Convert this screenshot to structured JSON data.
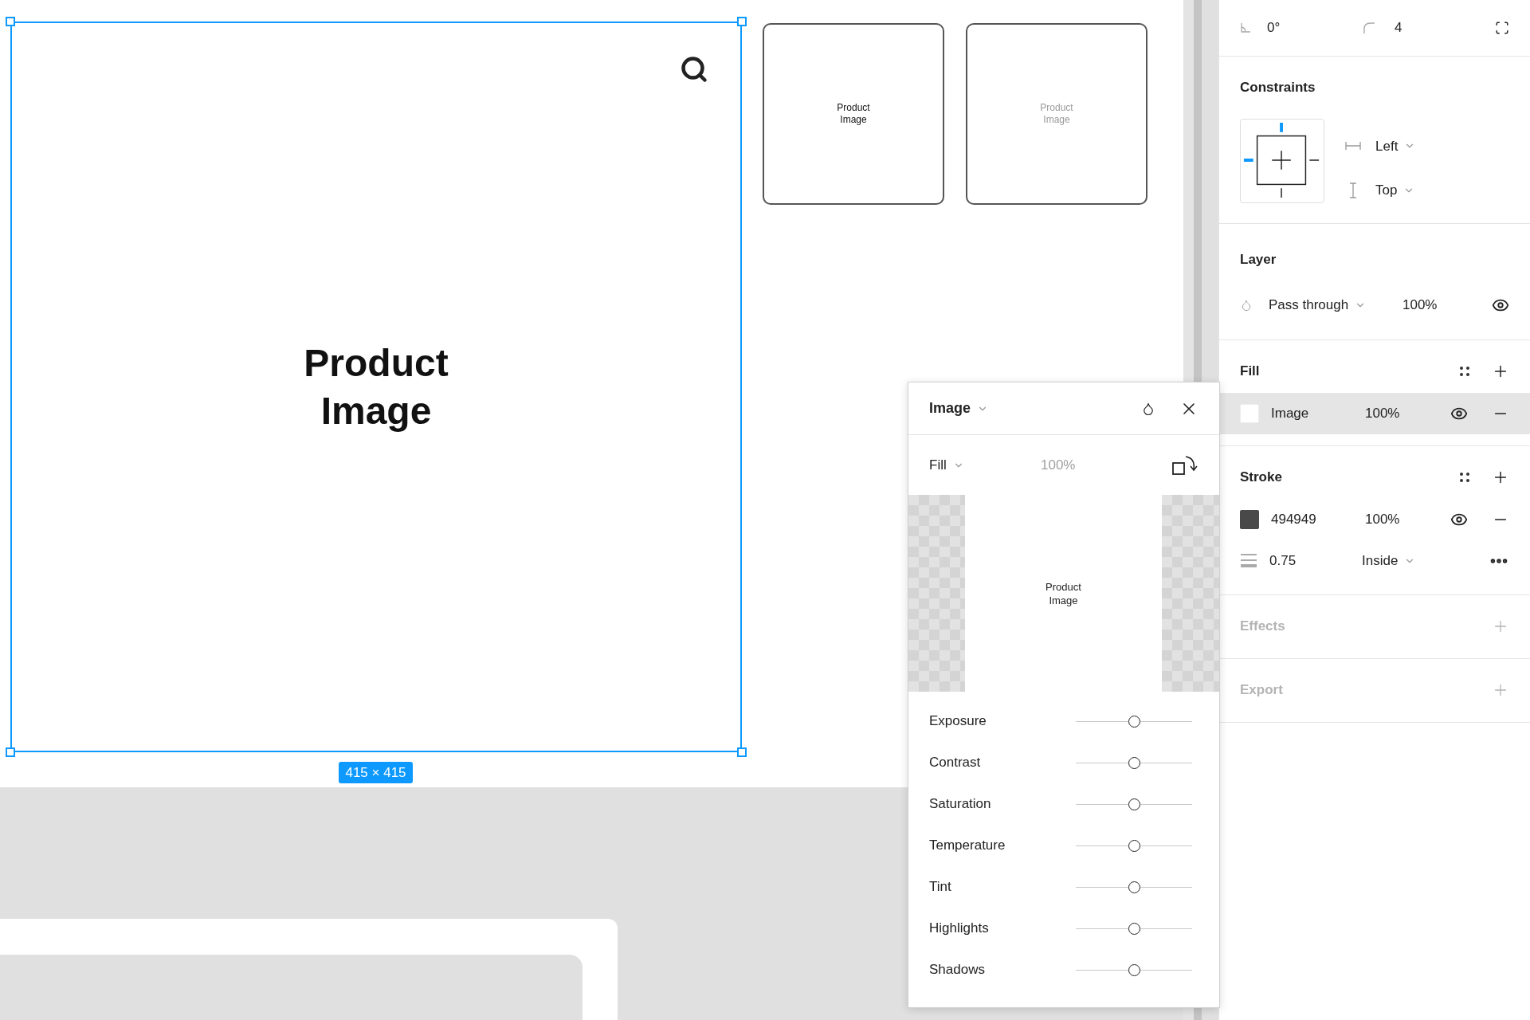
{
  "canvas": {
    "main_frame": {
      "label": "Product Image",
      "size_label": "415 × 415",
      "selected": true
    },
    "thumbnails": [
      {
        "label": "Product Image",
        "dimmed": false
      },
      {
        "label": "Product Image",
        "dimmed": true
      }
    ]
  },
  "image_popup": {
    "title": "Image",
    "mode": "Fill",
    "opacity": "100%",
    "preview_label": "Product Image",
    "adjustments": [
      {
        "label": "Exposure",
        "level": 0.5
      },
      {
        "label": "Contrast",
        "level": 0.5
      },
      {
        "label": "Saturation",
        "level": 0.5
      },
      {
        "label": "Temperature",
        "level": 0.5
      },
      {
        "label": "Tint",
        "level": 0.5
      },
      {
        "label": "Highlights",
        "level": 0.5
      },
      {
        "label": "Shadows",
        "level": 0.5
      }
    ]
  },
  "properties": {
    "rotation": "0°",
    "corner_radius": "4",
    "constraints": {
      "title": "Constraints",
      "horizontal": "Left",
      "vertical": "Top"
    },
    "layer": {
      "title": "Layer",
      "blend_mode": "Pass through",
      "opacity": "100%"
    },
    "fill": {
      "title": "Fill",
      "items": [
        {
          "type": "Image",
          "opacity": "100%",
          "selected": true
        }
      ]
    },
    "stroke": {
      "title": "Stroke",
      "color": "#494949",
      "hex": "494949",
      "opacity": "100%",
      "weight": "0.75",
      "position": "Inside"
    },
    "sections": [
      {
        "title": "Effects",
        "empty": true
      },
      {
        "title": "Export",
        "empty": true
      }
    ]
  }
}
